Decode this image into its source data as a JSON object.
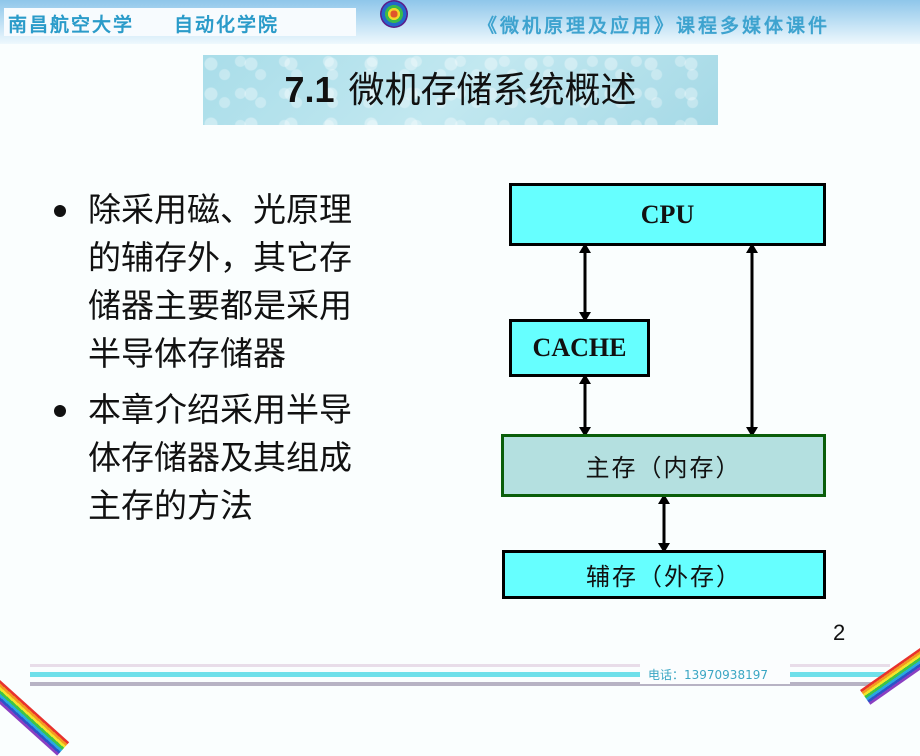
{
  "header": {
    "university": "南昌航空大学",
    "college": "自动化学院",
    "course": "《微机原理及应用》课程多媒体课件",
    "logo_icon": "target-icon"
  },
  "slide": {
    "title_number": "7.1",
    "title_text": "微机存储系统概述",
    "bullets": [
      {
        "lines": [
          "除采用磁、光原理",
          "的辅存外，其它存",
          "储器主要都是采用",
          "半导体存储器"
        ]
      },
      {
        "lines": [
          "本章介绍采用半导",
          "体存储器及其组成",
          "主存的方法"
        ]
      }
    ],
    "page_number": "2"
  },
  "diagram": {
    "nodes": {
      "cpu": "CPU",
      "cache": "CACHE",
      "main_memory": "主存（内存）",
      "aux_memory": "辅存（外存）"
    },
    "edges": [
      {
        "from": "cpu",
        "to": "cache",
        "type": "bidirectional"
      },
      {
        "from": "cache",
        "to": "main_memory",
        "type": "bidirectional"
      },
      {
        "from": "cpu",
        "to": "main_memory",
        "type": "bidirectional"
      },
      {
        "from": "main_memory",
        "to": "aux_memory",
        "type": "bidirectional"
      }
    ],
    "colors": {
      "box_fill": "#66ffff",
      "main_fill": "#b4e0e0",
      "main_border": "#0a5e0a"
    }
  },
  "footer": {
    "phone": "电话：13970938197"
  }
}
